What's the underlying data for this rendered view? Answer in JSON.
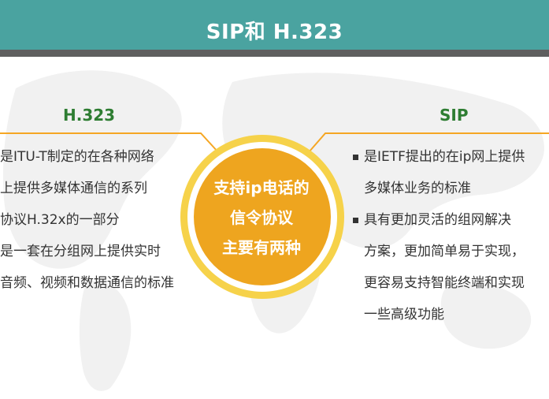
{
  "slide": {
    "title": "SIP和 H.323",
    "left": {
      "heading": "H.323",
      "lines": [
        "是ITU-T制定的在各种网络",
        "上提供多媒体通信的系列",
        "协议H.32x的一部分",
        "是一套在分组网上提供实时",
        "音频、视频和数据通信的标准"
      ]
    },
    "right": {
      "heading": "SIP",
      "items": [
        {
          "lines": [
            "是IETF提出的在ip网上提供",
            "多媒体业务的标准"
          ]
        },
        {
          "lines": [
            "具有更加灵活的组网解决",
            "方案，更加简单易于实现，",
            "更容易支持智能终端和实现",
            "一些高级功能"
          ]
        }
      ]
    },
    "center": {
      "lines": [
        "支持ip电话的",
        "信令协议",
        "主要有两种"
      ]
    }
  },
  "colors": {
    "header": "#4aa3a0",
    "header_rule": "#5f5f5f",
    "heading_green": "#2e7d32",
    "accent_orange": "#f5a623",
    "circle_outer": "#f6d24a",
    "circle_inner": "#eea51f",
    "body_text": "#333333"
  }
}
